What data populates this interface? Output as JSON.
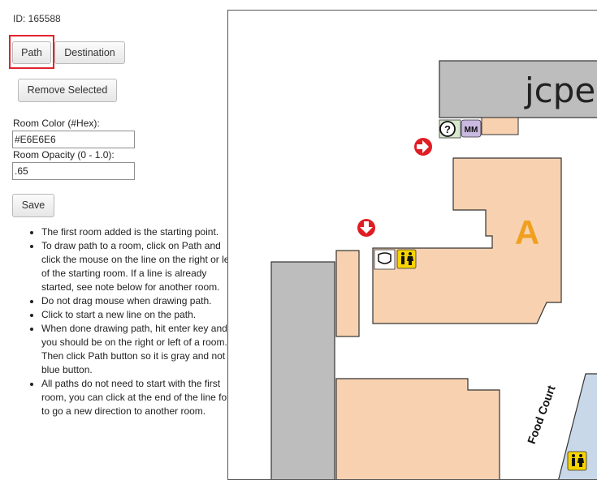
{
  "record": {
    "id_label": "ID: 165588"
  },
  "toolbar": {
    "path_label": "Path",
    "destination_label": "Destination",
    "remove_label": "Remove Selected"
  },
  "form": {
    "room_color_label": "Room Color (#Hex):",
    "room_color_value": "#E6E6E6",
    "room_opacity_label": "Room Opacity (0 - 1.0):",
    "room_opacity_value": ".65",
    "save_label": "Save"
  },
  "instructions": [
    "The first room added is the starting point.",
    "To draw path to a room, click on Path and click the mouse on the line on the right or left of the starting room. If a line is already started, see note below for another room.",
    "Do not drag mouse when drawing path.",
    "Click to start a new line on the path.",
    "When done drawing path, hit enter key and you should be on the right or left of a room. Then click Path button so it is gray and not blue button.",
    "All paths do not need to start with the first room, you can click at the end of the line for it to go a new direction to another room."
  ],
  "map": {
    "store_label": "jcpe",
    "room_label": "A",
    "area_label": "Food Court",
    "colors": {
      "room_fill": "#f8d2b0",
      "store_fill": "#bdbdbd",
      "corridor_fill": "#c8d8e8",
      "room_letter": "#f0a020",
      "arrow": "#e01c24",
      "restroom": "#f5d400"
    },
    "icons": [
      "help-icon",
      "atm-icon",
      "direction-arrow-right-icon",
      "direction-arrow-down-icon",
      "security-badge-icon",
      "restroom-icon"
    ]
  }
}
